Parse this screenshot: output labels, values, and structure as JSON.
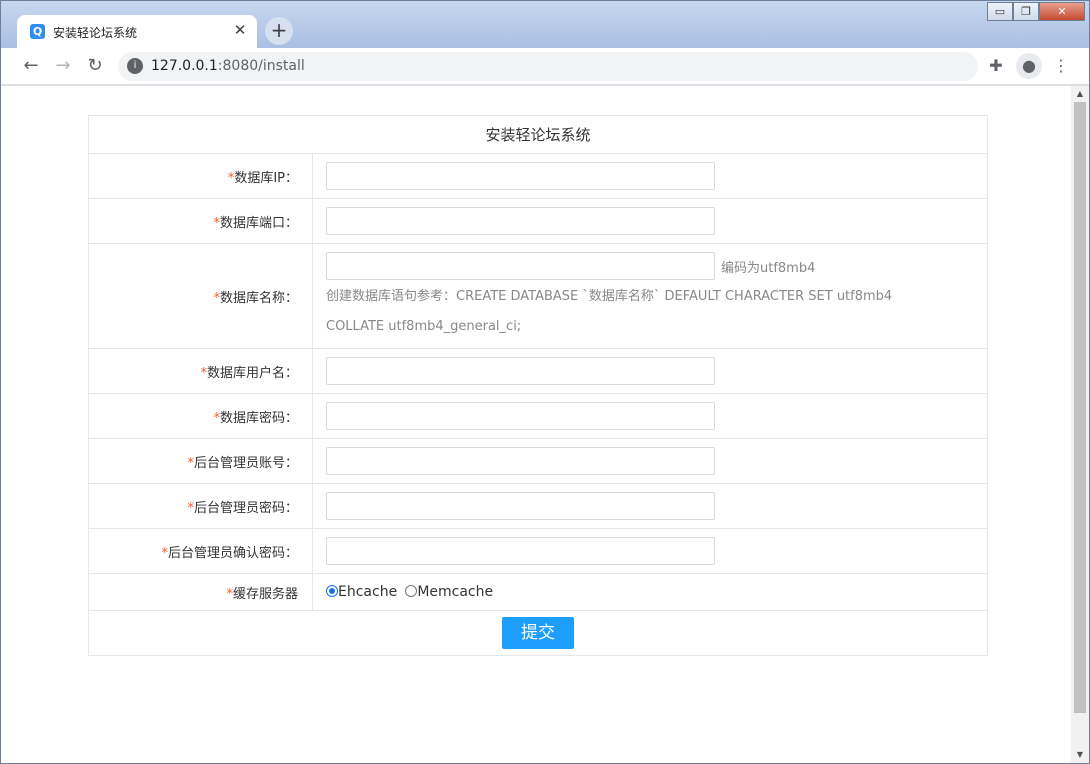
{
  "browser": {
    "tab_title": "安装轻论坛系统",
    "tab_favicon_letter": "Q",
    "tab_close": "✕",
    "new_tab": "+",
    "window_controls": {
      "minimize": "▭",
      "restore": "❐",
      "close": "✕"
    },
    "nav": {
      "back": "←",
      "forward": "→",
      "reload": "↻"
    },
    "url_host": "127.0.0.1",
    "url_rest": ":8080/install",
    "toolbar_icons": {
      "extensions": "✚",
      "profile": "●",
      "menu": "⋮"
    }
  },
  "form": {
    "title": "安装轻论坛系统",
    "required_mark": "*",
    "fields": [
      {
        "label": "数据库IP：",
        "value": ""
      },
      {
        "label": "数据库端口：",
        "value": ""
      },
      {
        "label": "数据库名称：",
        "value": ""
      },
      {
        "label": "数据库用户名：",
        "value": ""
      },
      {
        "label": "数据库密码：",
        "value": ""
      },
      {
        "label": "后台管理员账号：",
        "value": ""
      },
      {
        "label": "后台管理员密码：",
        "value": ""
      },
      {
        "label": "后台管理员确认密码：",
        "value": ""
      }
    ],
    "db_name_hint": "编码为utf8mb4",
    "db_name_reference_line1": "创建数据库语句参考：CREATE DATABASE `数据库名称` DEFAULT CHARACTER SET utf8mb4",
    "db_name_reference_line2": "COLLATE utf8mb4_general_ci;",
    "cache_label": "缓存服务器",
    "cache_options": [
      {
        "label": "Ehcache",
        "selected": true
      },
      {
        "label": "Memcache",
        "selected": false
      }
    ],
    "submit_label": "提交"
  },
  "colors": {
    "accent": "#1e9fff",
    "required": "#ff5722",
    "border": "#e6e6e6"
  }
}
